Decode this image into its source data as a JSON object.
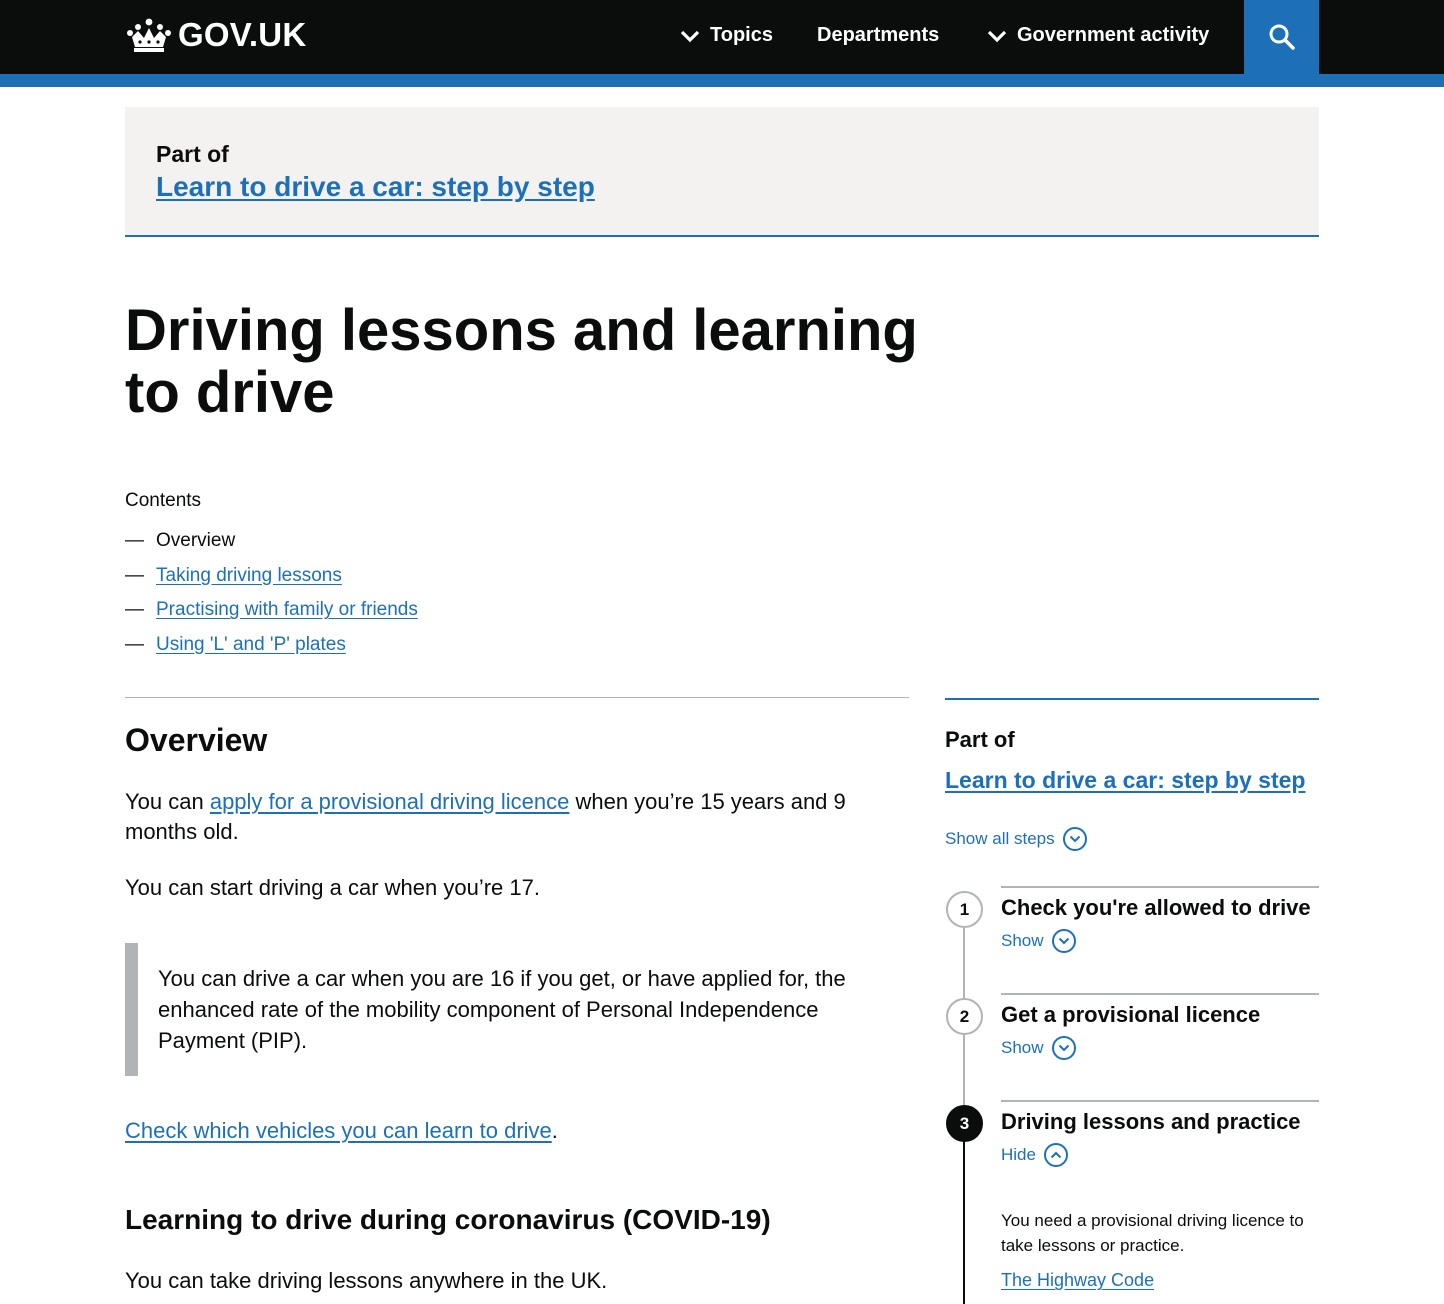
{
  "header": {
    "logo_text": "GOV.UK",
    "nav": [
      {
        "label": "Topics"
      },
      {
        "label": "Departments"
      },
      {
        "label": "Government activity"
      }
    ]
  },
  "partof": {
    "label": "Part of",
    "link": "Learn to drive a car: step by step"
  },
  "page": {
    "title": "Driving lessons and learning to drive"
  },
  "contents": {
    "heading": "Contents",
    "items": [
      {
        "label": "Overview"
      },
      {
        "label": "Taking driving lessons"
      },
      {
        "label": "Practising with family or friends"
      },
      {
        "label": "Using 'L' and 'P' plates"
      }
    ]
  },
  "overview": {
    "heading": "Overview",
    "p1_before": "You can ",
    "p1_link": "apply for a provisional driving licence",
    "p1_after": " when you’re 15 years and 9 months old.",
    "p2": "You can start driving a car when you’re 17.",
    "inset": "You can drive a car when you are 16 if you get, or have applied for, the enhanced rate of the mobility component of Personal Independence Payment (PIP).",
    "p3_link": "Check which vehicles you can learn to drive",
    "p3_after": ".",
    "covid_heading": "Learning to drive during coronavirus (COVID-19)",
    "p4": "You can take driving lessons anywhere in the UK."
  },
  "sidebar": {
    "partof_label": "Part of",
    "link": "Learn to drive a car: step by step",
    "show_all": "Show all steps",
    "steps": [
      {
        "number": "1",
        "title": "Check you're allowed to drive",
        "toggle": "Show"
      },
      {
        "number": "2",
        "title": "Get a provisional licence",
        "toggle": "Show"
      },
      {
        "number": "3",
        "title": "Driving lessons and practice",
        "toggle": "Hide"
      }
    ],
    "step3_desc": "You need a provisional driving licence to take lessons or practice.",
    "step3_link": "The Highway Code"
  },
  "colors": {
    "header_bg": "#0b0c0c",
    "brand_blue": "#1d70b8",
    "banner_bg": "#f3f2f1",
    "border_grey": "#b1b4b6"
  }
}
